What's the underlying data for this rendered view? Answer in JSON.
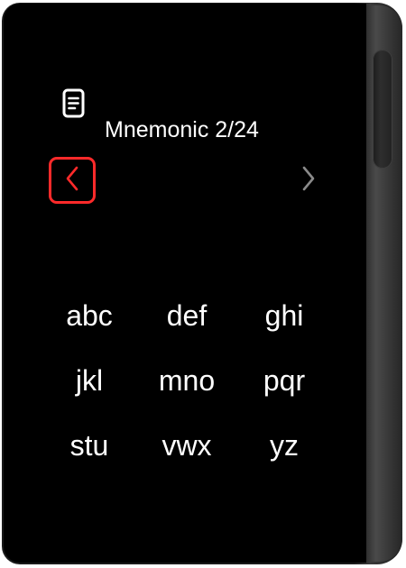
{
  "screen": {
    "title": "Mnemonic 2/24"
  },
  "icons": {
    "header": "document-icon",
    "prev": "chevron-left-icon",
    "next": "chevron-right-icon"
  },
  "keypad": {
    "keys": [
      "abc",
      "def",
      "ghi",
      "jkl",
      "mno",
      "pqr",
      "stu",
      "vwx",
      "yz"
    ]
  },
  "colors": {
    "background": "#000000",
    "text": "#ffffff",
    "highlight": "#ff2a2a",
    "inactive_chevron": "#8a8a8a"
  }
}
